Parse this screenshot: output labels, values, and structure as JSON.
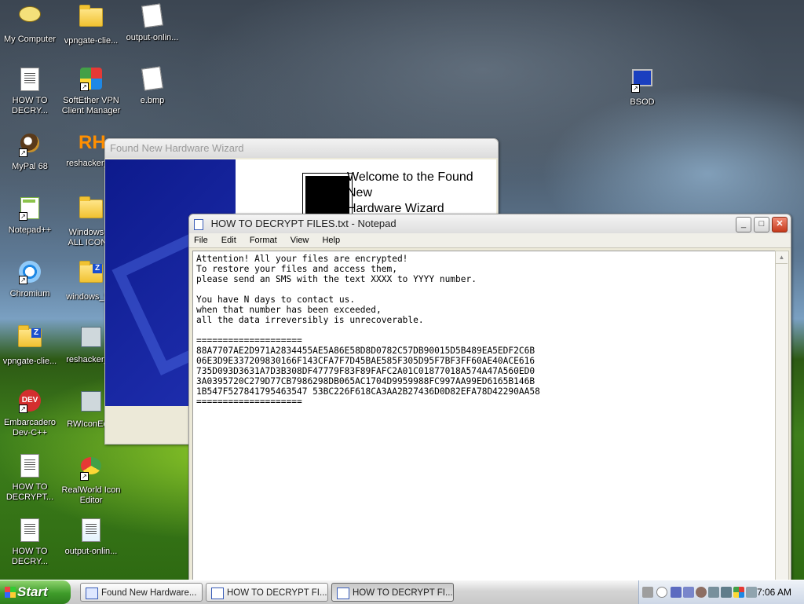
{
  "desktop_icons": [
    {
      "label": "My Computer",
      "type": "mycomputer"
    },
    {
      "label": "vpngate-clie...",
      "type": "folder"
    },
    {
      "label": "output-onlin...",
      "type": "paint"
    },
    {
      "label": "HOW TO DECRY...",
      "type": "doc"
    },
    {
      "label": "SoftEther VPN Client Manager",
      "type": "softether"
    },
    {
      "label": "e.bmp",
      "type": "paint"
    },
    {
      "label": "MyPal 68",
      "type": "mypal"
    },
    {
      "label": "reshacker_...",
      "type": "rh"
    },
    {
      "label": "Notepad++",
      "type": "npp"
    },
    {
      "label": "Windows ... ALL ICON...",
      "type": "folder"
    },
    {
      "label": "Chromium",
      "type": "chromium"
    },
    {
      "label": "windows_9...",
      "type": "zfolder"
    },
    {
      "label": "vpngate-clie...",
      "type": "zfolder"
    },
    {
      "label": "reshacker_...",
      "type": "installer"
    },
    {
      "label": "Embarcadero Dev-C++",
      "type": "devcpp"
    },
    {
      "label": "RWIconEd...",
      "type": "installer"
    },
    {
      "label": "HOW TO DECRYPT...",
      "type": "doc"
    },
    {
      "label": "RealWorld Icon Editor",
      "type": "rwicon"
    },
    {
      "label": "HOW TO DECRY...",
      "type": "doc"
    },
    {
      "label": "output-onlin...",
      "type": "doc2"
    },
    {
      "label": "BSOD",
      "type": "bsod"
    }
  ],
  "wizard": {
    "title": "Found New Hardware Wizard",
    "heading_line1": "Welcome to the Found New",
    "heading_line2": "Hardware Wizard"
  },
  "notepad": {
    "title": "HOW TO DECRYPT FILES.txt - Notepad",
    "menu": [
      "File",
      "Edit",
      "Format",
      "View",
      "Help"
    ],
    "content": "Attention! All your files are encrypted!\nTo restore your files and access them,\nplease send an SMS with the text XXXX to YYYY number.\n\nYou have N days to contact us.\nwhen that number has been exceeded,\nall the data irreversibly is unrecoverable.\n\n====================\n88A7707AE2D971A2834455AE5A86E58D8D0782C57DB90015D5B489EA5EDF2C6B\n06E3D9E337209830166F143CFA7F7D45BAE585F305D95F7BF3FF60AE40ACE616\n735D093D3631A7D3B308DF47779F83F89FAFC2A01C01877018A574A47A560ED0\n3A0395720C279D77CB7986298DB065AC1704D9959988FC997AA99ED6165B146B\n1B547F527841795463547 53BC226F618CA3AA2B27436D0D82EFA78D42290AA58\n===================="
  },
  "taskbar": {
    "start_label": "Start",
    "tasks": [
      {
        "label": "Found New Hardware...",
        "active": false
      },
      {
        "label": "HOW TO DECRYPT FI...",
        "active": false
      },
      {
        "label": "HOW TO DECRYPT FI...",
        "active": true
      }
    ],
    "clock": "7:06 AM"
  }
}
